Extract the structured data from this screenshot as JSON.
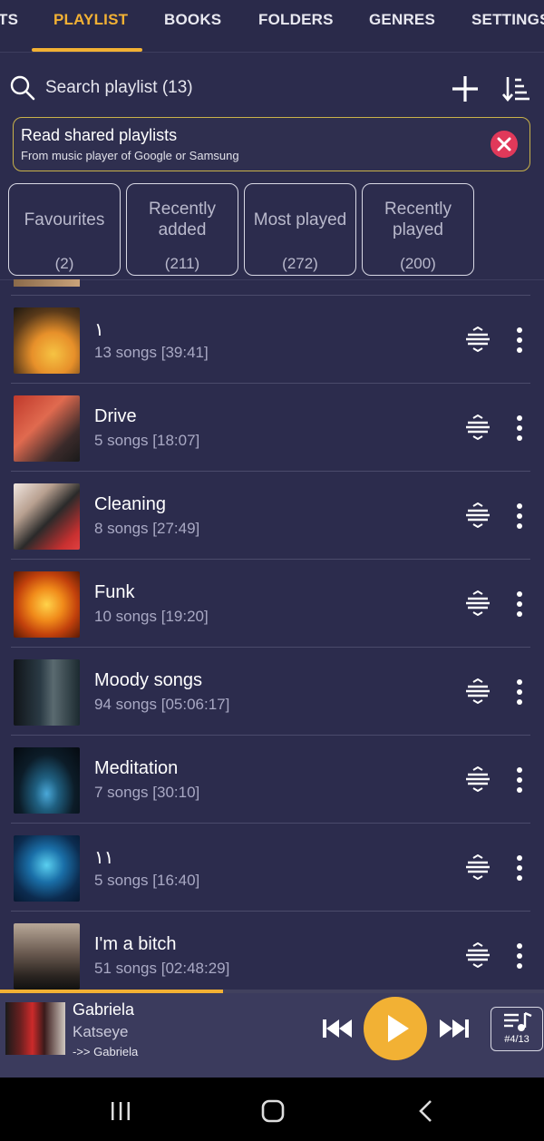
{
  "tabs": [
    {
      "label": "TS",
      "active": false
    },
    {
      "label": "PLAYLIST",
      "active": true
    },
    {
      "label": "BOOKS",
      "active": false
    },
    {
      "label": "FOLDERS",
      "active": false
    },
    {
      "label": "GENRES",
      "active": false
    },
    {
      "label": "SETTINGS",
      "active": false
    }
  ],
  "search": {
    "placeholder": "Search playlist (13)"
  },
  "banner": {
    "title": "Read shared playlists",
    "subtitle": "From music player of Google or Samsung"
  },
  "cards": [
    {
      "label1": "Favourites",
      "label2": "",
      "count": "(2)"
    },
    {
      "label1": "Recently",
      "label2": "added",
      "count": "(211)"
    },
    {
      "label1": "Most played",
      "label2": "",
      "count": "(272)"
    },
    {
      "label1": "Recently",
      "label2": "played",
      "count": "(200)"
    }
  ],
  "playlists": [
    {
      "title": "١",
      "subtitle": "13 songs [39:41]"
    },
    {
      "title": "Drive",
      "subtitle": "5 songs [18:07]"
    },
    {
      "title": "Cleaning",
      "subtitle": "8 songs [27:49]"
    },
    {
      "title": "Funk",
      "subtitle": "10 songs [19:20]"
    },
    {
      "title": "Moody songs",
      "subtitle": "94 songs [05:06:17]"
    },
    {
      "title": "Meditation",
      "subtitle": "7 songs [30:10]"
    },
    {
      "title": "١١",
      "subtitle": "5 songs [16:40]"
    },
    {
      "title": "I'm a bitch",
      "subtitle": "51 songs [02:48:29]"
    }
  ],
  "player": {
    "title": "Gabriela",
    "artist": "Katseye",
    "album": "->> Gabriela",
    "queue_position": "#4/13",
    "progress": 0.41
  },
  "colors": {
    "accent": "#f2b134",
    "background": "#2c2c4d",
    "close": "#e0395a"
  }
}
